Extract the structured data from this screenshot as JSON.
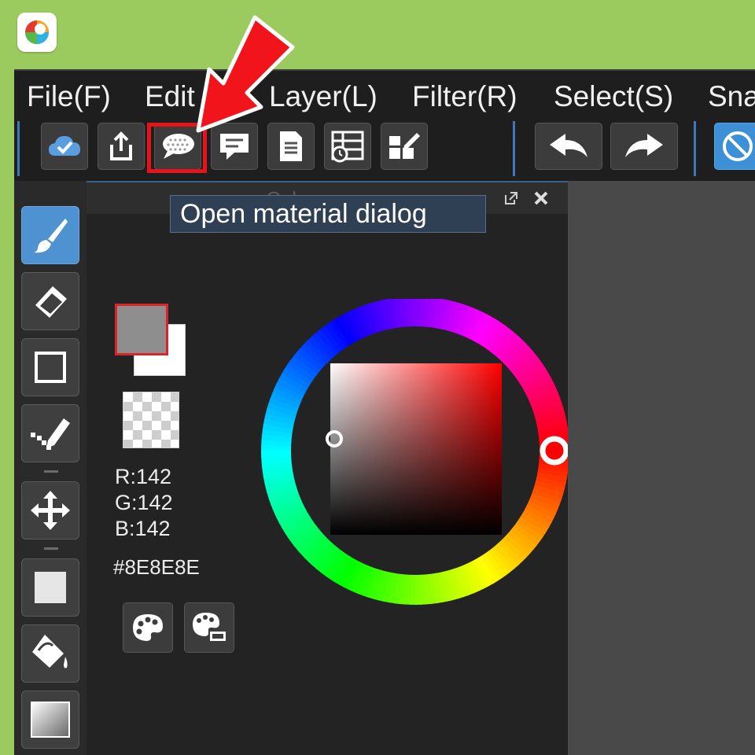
{
  "menu": {
    "items": [
      "File(F)",
      "Edit",
      "Layer(L)",
      "Filter(R)",
      "Select(S)",
      "Sna"
    ]
  },
  "toolbar": {
    "buttons": [
      {
        "name": "cloud-check-icon"
      },
      {
        "name": "share-icon"
      },
      {
        "name": "speech-bubble-icon",
        "highlighted": true
      },
      {
        "name": "comment-icon"
      },
      {
        "name": "document-icon"
      },
      {
        "name": "material-list-icon"
      },
      {
        "name": "edit-grid-icon"
      },
      {
        "name": "undo-icon"
      },
      {
        "name": "redo-icon"
      },
      {
        "name": "no-entry-icon"
      }
    ]
  },
  "tooltip": {
    "text": "Open material dialog"
  },
  "color_panel": {
    "title": "Color",
    "rgb": {
      "r": "R:142",
      "g": "G:142",
      "b": "B:142"
    },
    "hex": "#8E8E8E",
    "main_color": "#8e8e8e",
    "sub_color": "#ffffff",
    "hue_marker_color": "#ff0000"
  },
  "tools": [
    {
      "name": "brush-tool-icon",
      "active": true
    },
    {
      "name": "eraser-tool-icon"
    },
    {
      "name": "rectangle-select-icon"
    },
    {
      "name": "dot-pen-icon"
    },
    {
      "name": "move-tool-icon"
    },
    {
      "name": "fill-rect-icon"
    },
    {
      "name": "bucket-fill-icon"
    },
    {
      "name": "gradient-tool-icon"
    }
  ],
  "colors": {
    "background": "#9bcb5e",
    "accent_blue": "#3d8fd6",
    "highlight_red": "#e8121b"
  }
}
